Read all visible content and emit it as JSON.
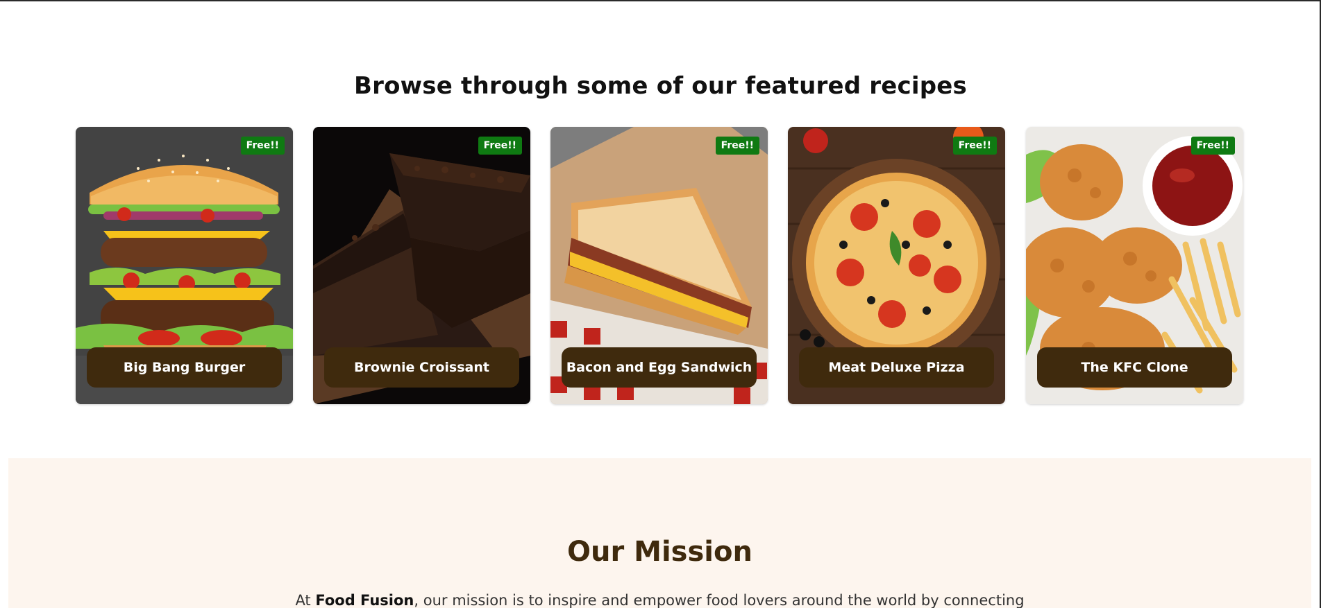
{
  "featured": {
    "title": "Browse through some of our featured recipes",
    "cards": [
      {
        "name": "Big Bang Burger",
        "badge": "Free!!",
        "image": "burger-image"
      },
      {
        "name": "Brownie Croissant",
        "badge": "Free!!",
        "image": "brownie-image"
      },
      {
        "name": "Bacon and Egg Sandwich",
        "badge": "Free!!",
        "image": "sandwich-image"
      },
      {
        "name": "Meat Deluxe Pizza",
        "badge": "Free!!",
        "image": "pizza-image"
      },
      {
        "name": "The KFC Clone",
        "badge": "Free!!",
        "image": "fried-chicken-image"
      }
    ]
  },
  "mission": {
    "title": "Our Mission",
    "text_prefix": "At ",
    "brand": "Food Fusion",
    "text_suffix": ", our mission is to inspire and empower food lovers around the world by connecting"
  },
  "colors": {
    "badge": "#0f7a12",
    "pill": "#3f2a0d",
    "mission_bg": "#fdf5ee",
    "mission_title": "#3f2a0d"
  }
}
